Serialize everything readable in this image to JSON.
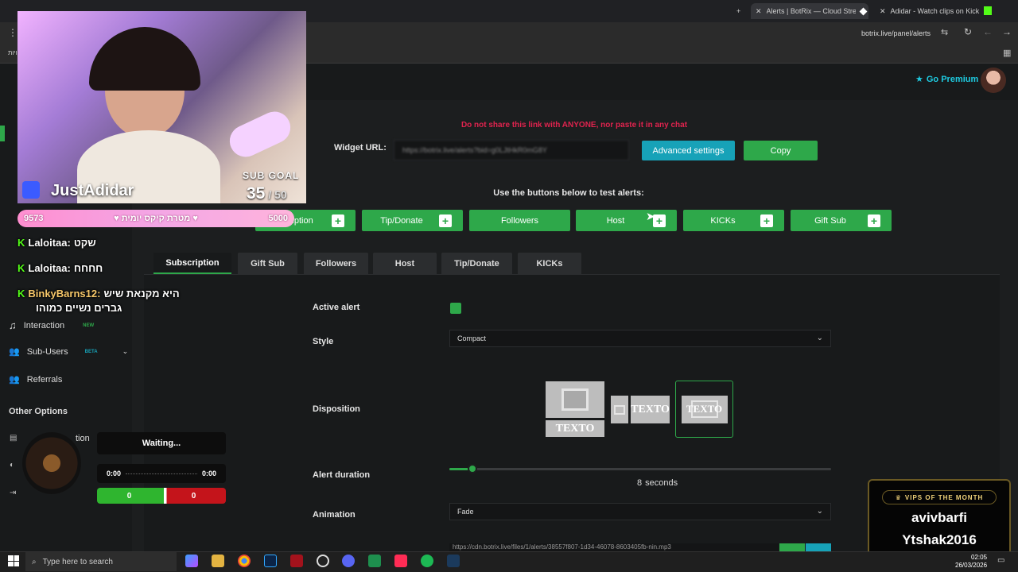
{
  "browser": {
    "tabs": [
      {
        "title": "Alerts | BotRix — Cloud Stream"
      },
      {
        "title": "Adidar - Watch clips on Kick"
      }
    ],
    "url": "botrix.live/panel/alerts",
    "bookmark_text": "גויות"
  },
  "header": {
    "go_premium": "Go Premium"
  },
  "warning": "Do not share this link with ANYONE, nor paste it in any chat",
  "widget": {
    "label": "Widget URL:",
    "value": "https://botrix.live/alerts?bid=g0LJtHkR0mG8Y",
    "advanced_settings": "Advanced settings",
    "copy": "Copy"
  },
  "test_section": {
    "title": "Use the buttons below to test alerts:",
    "buttons": [
      "Subscription",
      "Tip/Donate",
      "Followers",
      "Host",
      "KICKs",
      "Gift Sub"
    ],
    "first_visible_text": "cription"
  },
  "tabs": [
    "Subscription",
    "Gift Sub",
    "Followers",
    "Host",
    "Tip/Donate",
    "KICKs"
  ],
  "form": {
    "active_alert_label": "Active alert",
    "active_alert_on": true,
    "style_label": "Style",
    "style_value": "Compact",
    "disposition_label": "Disposition",
    "texto": "TEXTO",
    "alert_duration_label": "Alert duration",
    "duration_value": "8",
    "duration_unit": "seconds",
    "duration_fraction": 0.06,
    "animation_label": "Animation",
    "animation_value": "Fade",
    "sound_url": "https://cdn.botrix.live/files/1/alerts/38557f807-1d34-46078-8603405fb-nin.mp3"
  },
  "sidebar": {
    "items": [
      {
        "label": "Interaction",
        "badge": "NEW"
      },
      {
        "label": "Sub-Users",
        "badge": "BETA"
      },
      {
        "label": "Referrals",
        "badge": ""
      }
    ],
    "other_options": "Other Options",
    "partial_items": [
      "L",
      "In",
      "M"
    ],
    "partial_option": "tion"
  },
  "overlay": {
    "streamer_name": "JustAdidar",
    "sub_goal_label": "SUB GOAL",
    "sub_goal_current": "35",
    "sub_goal_total": "/ 50",
    "goal_bar": {
      "left": "9573",
      "center": "מטרת קיקס יומית",
      "right": "5000"
    },
    "chat": [
      {
        "user": "Laloitaa:",
        "message": "שקט"
      },
      {
        "user": "Laloitaa:",
        "message": "חחחח"
      },
      {
        "user": "BinkyBarns12:",
        "message": "היא מקנאת שיש",
        "message2": "גברים נשיים כמוהו"
      }
    ],
    "music": {
      "status": "Waiting...",
      "time_start": "0:00",
      "time_end": "0:00",
      "vote_left": "0",
      "vote_right": "0"
    },
    "vips": {
      "title": "VIPS OF THE MONTH",
      "names": [
        "avivbarfi",
        "Ytshak2016"
      ]
    }
  },
  "taskbar": {
    "search_placeholder": "Type here to search",
    "time": "02:05",
    "date": "26/03/2026"
  },
  "colors": {
    "accent_green": "#2ea84a",
    "warning_red": "#e0234e",
    "teal": "#17a2b8",
    "premium_cyan": "#1ecbe1"
  }
}
